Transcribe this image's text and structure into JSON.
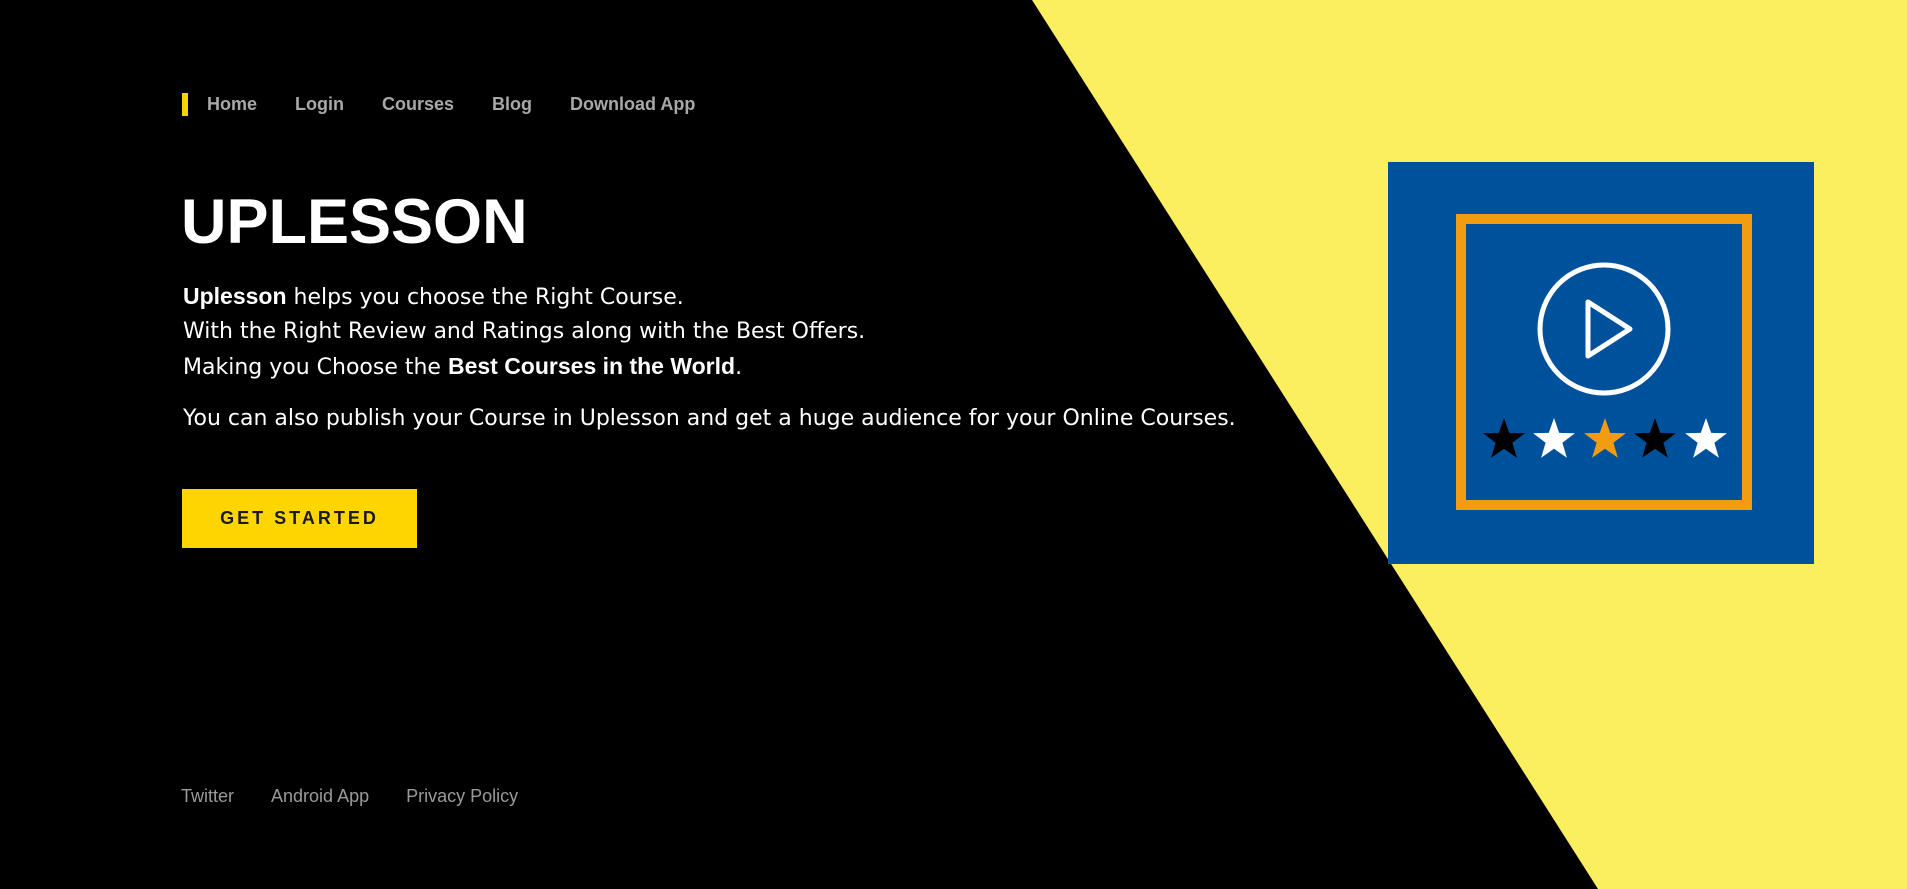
{
  "nav": {
    "items": [
      {
        "label": "Home"
      },
      {
        "label": "Login"
      },
      {
        "label": "Courses"
      },
      {
        "label": "Blog"
      },
      {
        "label": "Download App"
      }
    ]
  },
  "hero": {
    "title": "UPLESSON",
    "line1_bold": "Uplesson",
    "line1_rest": " helps you choose the Right Course.",
    "line2": "With the Right Review and Ratings along with the Best Offers.",
    "line3_start": "Making you Choose the ",
    "line3_bold": "Best Courses in the World",
    "line3_end": ".",
    "publish_text": "You can also publish your Course in Uplesson and get a huge audience for your Online Courses.",
    "cta_label": "GET STARTED"
  },
  "footer": {
    "links": [
      {
        "label": "Twitter"
      },
      {
        "label": "Android App"
      },
      {
        "label": "Privacy Policy"
      }
    ]
  },
  "logo": {
    "icon": "play-circle-icon",
    "rating_stars": 5,
    "colors": {
      "background": "#00519c",
      "frame": "#f29c12",
      "star_dark": "#000000",
      "star_light": "#ffffff",
      "star_accent": "#f29c12"
    }
  },
  "colors": {
    "page_bg": "#000000",
    "accent_yellow": "#fbee5f",
    "button_yellow": "#ffd500",
    "nav_text": "#a8a8a8"
  }
}
